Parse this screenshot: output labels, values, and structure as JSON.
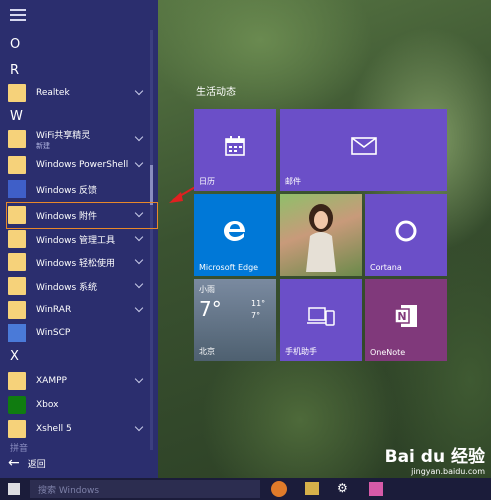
{
  "start_menu": {
    "section_letters": [
      "O",
      "R",
      "W",
      "X",
      "拼音"
    ],
    "apps": [
      {
        "label": "Realtek",
        "has_chevron": true
      },
      {
        "label": "WiFi共享精灵",
        "sub": "新建",
        "has_chevron": true
      },
      {
        "label": "Windows PowerShell",
        "has_chevron": true
      },
      {
        "label": "Windows 反馈",
        "has_chevron": false
      },
      {
        "label": "Windows 附件",
        "has_chevron": true
      },
      {
        "label": "Windows 管理工具",
        "has_chevron": true
      },
      {
        "label": "Windows 轻松使用",
        "has_chevron": true
      },
      {
        "label": "Windows 系统",
        "has_chevron": true
      },
      {
        "label": "WinRAR",
        "has_chevron": true
      },
      {
        "label": "WinSCP",
        "has_chevron": false
      },
      {
        "label": "XAMPP",
        "has_chevron": true
      },
      {
        "label": "Xbox",
        "has_chevron": false
      },
      {
        "label": "Xshell 5",
        "has_chevron": true
      }
    ],
    "back_label": "返回"
  },
  "tiles": {
    "group_title": "生活动态",
    "calendar": "日历",
    "mail": "邮件",
    "edge": "Microsoft Edge",
    "cortana": "Cortana",
    "weather": {
      "condition": "小雨",
      "temp": "7°",
      "high": "11°",
      "low": "7°",
      "city": "北京"
    },
    "phone": "手机助手",
    "onenote": "OneNote"
  },
  "taskbar": {
    "search_placeholder": "搜索 Windows"
  },
  "watermark": {
    "main": "Bai du 经验",
    "sub": "jingyan.baidu.com"
  },
  "colors": {
    "panel": "#2b2e6e",
    "tile_purple": "#6b4fc8",
    "tile_blue": "#0078d7",
    "highlight": "#e8882a",
    "arrow": "#e02020"
  }
}
